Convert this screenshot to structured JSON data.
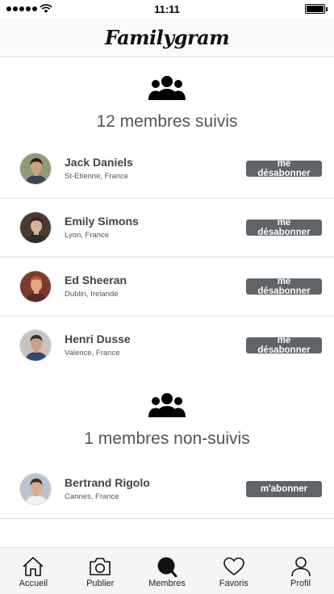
{
  "status_bar": {
    "time": "11:11"
  },
  "header": {
    "logo": "Familygram"
  },
  "followed": {
    "title": "12 membres suivis",
    "members": [
      {
        "name": "Jack Daniels",
        "city": "St-Etienne, France",
        "action": "me désabonner",
        "avatar": {
          "skin": "#c9a083",
          "hair": "#2a2017",
          "bg": "#8f9a7a",
          "shirt": "#3b4552"
        }
      },
      {
        "name": "Emily Simons",
        "city": "Lyon, France",
        "action": "me désabonner",
        "avatar": {
          "skin": "#d8b39b",
          "hair": "#3b2418",
          "bg": "#4a3a30",
          "shirt": "#2e2e2e"
        }
      },
      {
        "name": "Ed Sheeran",
        "city": "Dublin, Irelande",
        "action": "me désabonner",
        "avatar": {
          "skin": "#e0a784",
          "hair": "#b8562a",
          "bg": "#7a3b2e",
          "shirt": "#5a2a26"
        }
      },
      {
        "name": "Henri Dusse",
        "city": "Valence, France",
        "action": "me désabonner",
        "avatar": {
          "skin": "#caa089",
          "hair": "#3a2e27",
          "bg": "#c8c3bd",
          "shirt": "#2f4a6e"
        }
      }
    ]
  },
  "unfollowed": {
    "title": "1 membres non-suivis",
    "members": [
      {
        "name": "Bertrand Rigolo",
        "city": "Cannes, France",
        "action": "m'abonner",
        "avatar": {
          "skin": "#d6ad92",
          "hair": "#3d2c22",
          "bg": "#b9c4cf",
          "shirt": "#f2f2f2"
        }
      }
    ]
  },
  "tabs": [
    {
      "label": "Accueil",
      "icon": "home-icon"
    },
    {
      "label": "Publier",
      "icon": "camera-icon"
    },
    {
      "label": "Membres",
      "icon": "search-icon"
    },
    {
      "label": "Favoris",
      "icon": "heart-icon"
    },
    {
      "label": "Profil",
      "icon": "user-icon"
    }
  ]
}
